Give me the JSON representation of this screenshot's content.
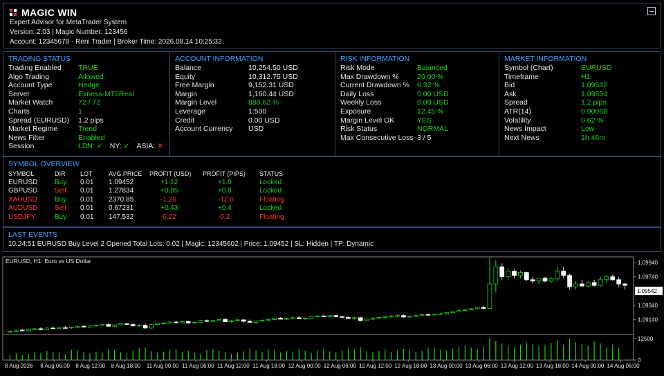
{
  "header": {
    "title": "MAGIC WIN",
    "subtitle": "Expert Advisor for MetaTrader System",
    "version_line": "Version: 2.03   |   Magic Number: 123456",
    "account_line": "Account: 12345678 - Reni Trader   |   Broker Time: 2026.08.14 10:25:32",
    "logo_colors": [
      "#d93b3b",
      "#ffffff",
      "#ffffff",
      "#d93b3b"
    ]
  },
  "trading_status": {
    "title": "TRADING STATUS",
    "rows": [
      {
        "k": "Trading Enabled",
        "v": "TRUE",
        "c": "green"
      },
      {
        "k": "Algo Trading",
        "v": "Allowed",
        "c": "green"
      },
      {
        "k": "Account Type",
        "v": "Hedge",
        "c": "green"
      },
      {
        "k": "Server",
        "v": "Exness-MT5Real",
        "c": "green"
      },
      {
        "k": "Market Watch",
        "v": "72 / 72",
        "c": "green"
      },
      {
        "k": "Charts",
        "v": "1",
        "c": "green"
      },
      {
        "k": "Spread (EURUSD)",
        "v": "1.2 pips",
        "c": "white"
      },
      {
        "k": "Market Regime",
        "v": "Trend",
        "c": "green"
      },
      {
        "k": "News Filter",
        "v": "Enabled",
        "c": "green"
      }
    ],
    "session_label": "Session",
    "sessions": [
      {
        "name": "LDN:",
        "mark": "✓",
        "c": "green"
      },
      {
        "name": "NY:",
        "mark": "✓",
        "c": "green"
      },
      {
        "name": "ASIA:",
        "mark": "✕",
        "c": "red"
      }
    ]
  },
  "account_info": {
    "title": "ACCOUNT INFORMATION",
    "rows": [
      {
        "k": "Balance",
        "v": "10,254.50 USD",
        "c": "white"
      },
      {
        "k": "Equity",
        "v": "10,312.75 USD",
        "c": "white"
      },
      {
        "k": "Free Margin",
        "v": "9,152.31 USD",
        "c": "white"
      },
      {
        "k": "Margin",
        "v": "1,160.44 USD",
        "c": "white"
      },
      {
        "k": "Margin Level",
        "v": "888.62 %",
        "c": "green"
      },
      {
        "k": "Leverage",
        "v": "1:500",
        "c": "white"
      },
      {
        "k": "Credit",
        "v": "0.00 USD",
        "c": "white"
      },
      {
        "k": "Account Currency",
        "v": "USD",
        "c": "white"
      }
    ]
  },
  "risk_info": {
    "title": "RISK INFORMATION",
    "rows": [
      {
        "k": "Risk Mode",
        "v": "Balanced",
        "c": "green"
      },
      {
        "k": "Max Drawdown %",
        "v": "20.00 %",
        "c": "green"
      },
      {
        "k": "Current Drawdown %",
        "v": "6.32 %",
        "c": "green"
      },
      {
        "k": "Daily Loss",
        "v": "0.00 USD",
        "c": "green"
      },
      {
        "k": "Weekly Loss",
        "v": "0.00 USD",
        "c": "green"
      },
      {
        "k": "Exposure",
        "v": "12.45 %",
        "c": "green"
      },
      {
        "k": "Margin Level OK",
        "v": "YES",
        "c": "green"
      },
      {
        "k": "Risk Status",
        "v": "NORMAL",
        "c": "green"
      },
      {
        "k": "Max Consecutive Loss",
        "v": "3 / 5",
        "c": "white"
      }
    ]
  },
  "market_info": {
    "title": "MARKET INFORMATION",
    "rows": [
      {
        "k": "Symbol (Chart)",
        "v": "EURUSD",
        "c": "green"
      },
      {
        "k": "Timeframe",
        "v": "H1",
        "c": "green"
      },
      {
        "k": "Bid",
        "v": "1.09542",
        "c": "green"
      },
      {
        "k": "Ask",
        "v": "1.09554",
        "c": "green"
      },
      {
        "k": "Spread",
        "v": "1.2 pips",
        "c": "green"
      },
      {
        "k": "ATR(14)",
        "v": "0.00068",
        "c": "green"
      },
      {
        "k": "Volatility",
        "v": "0.62 %",
        "c": "green"
      },
      {
        "k": "News Impact",
        "v": "Low",
        "c": "green"
      },
      {
        "k": "Next News",
        "v": "1h 46m",
        "c": "green"
      }
    ]
  },
  "symbol_overview": {
    "title": "SYMBOL OVERVIEW",
    "headers": [
      "SYMBOL",
      "DIR",
      "LOT",
      "AVG PRICE",
      "PROFIT (USD)",
      "PROFIT (PIPS)",
      "STATUS"
    ],
    "rows": [
      {
        "symbol": "EURUSD",
        "dir": "Buy",
        "lot": "0.01",
        "avg": "1.09452",
        "usd": "+1.12",
        "pips": "+1.0",
        "status": "Locked",
        "sc": "white",
        "dc": "green",
        "pc": "green",
        "stc": "green"
      },
      {
        "symbol": "GBPUSD",
        "dir": "Sell",
        "lot": "0.01",
        "avg": "1.27834",
        "usd": "+0.85",
        "pips": "+0.8",
        "status": "Locked",
        "sc": "white",
        "dc": "red",
        "pc": "green",
        "stc": "green"
      },
      {
        "symbol": "XAUUSD",
        "dir": "Buy",
        "lot": "0.01",
        "avg": "2370.85",
        "usd": "-1.26",
        "pips": "-12.6",
        "status": "Floating",
        "sc": "red",
        "dc": "green",
        "pc": "red",
        "stc": "red"
      },
      {
        "symbol": "AUDUSD",
        "dir": "Sell",
        "lot": "0.01",
        "avg": "0.67231",
        "usd": "+0.43",
        "pips": "+0.4",
        "status": "Locked",
        "sc": "red",
        "dc": "red",
        "pc": "green",
        "stc": "green"
      },
      {
        "symbol": "USDJPY",
        "dir": "Buy",
        "lot": "0.01",
        "avg": "147.532",
        "usd": "-0.22",
        "pips": "-0.2",
        "status": "Floating",
        "sc": "red",
        "dc": "green",
        "pc": "red",
        "stc": "red"
      }
    ]
  },
  "last_events": {
    "title": "LAST EVENTS",
    "line": "10:24:51   EURUSD   Buy Level 2 Opened   Total Lots: 0.02   |   Magic: 12345602   |   Price: 1.09452   |   SL: Hidden   |   TP: Dynamic"
  },
  "chart_data": {
    "type": "candlestick",
    "title": "EURUSD, H1:  Euro vs US Dollar",
    "bid_label": "1.09542",
    "y_tick_labels": [
      "1.09940",
      "1.09740",
      "1.09340",
      "1.09140"
    ],
    "y_ticks": [
      1.0994,
      1.0974,
      1.0934,
      1.0914
    ],
    "ylim": [
      1.0894,
      1.1
    ],
    "volume_tick_labels": [
      "12500",
      "0"
    ],
    "volume_ylim": [
      0,
      14000
    ],
    "x_tick_labels": [
      "8 Aug 2026",
      "8 Aug 06:00",
      "8 Aug 12:00",
      "8 Aug 18:00",
      "11 Aug 00:00",
      "11 Aug 06:00",
      "11 Aug 12:00",
      "11 Aug 18:00",
      "12 Aug 00:00",
      "12 Aug 06:00",
      "12 Aug 12:00",
      "12 Aug 18:00",
      "13 Aug 00:00",
      "13 Aug 06:00",
      "13 Aug 12:00",
      "13 Aug 18:00",
      "14 Aug 00:00",
      "14 Aug 06:00"
    ],
    "candles": [
      {
        "o": 1.0896,
        "h": 1.08985,
        "l": 1.0895,
        "c": 1.08975
      },
      {
        "o": 1.08975,
        "h": 1.09,
        "l": 1.08965,
        "c": 1.0899
      },
      {
        "o": 1.0899,
        "h": 1.0901,
        "l": 1.08975,
        "c": 1.0898
      },
      {
        "o": 1.0898,
        "h": 1.09015,
        "l": 1.0897,
        "c": 1.09005
      },
      {
        "o": 1.09005,
        "h": 1.09025,
        "l": 1.08995,
        "c": 1.0901
      },
      {
        "o": 1.0901,
        "h": 1.0903,
        "l": 1.0899,
        "c": 1.09
      },
      {
        "o": 1.09,
        "h": 1.0903,
        "l": 1.08995,
        "c": 1.0902
      },
      {
        "o": 1.0902,
        "h": 1.0904,
        "l": 1.09005,
        "c": 1.09015
      },
      {
        "o": 1.09015,
        "h": 1.09035,
        "l": 1.09005,
        "c": 1.09025
      },
      {
        "o": 1.09025,
        "h": 1.09045,
        "l": 1.0901,
        "c": 1.0902
      },
      {
        "o": 1.0902,
        "h": 1.0904,
        "l": 1.0901,
        "c": 1.0903
      },
      {
        "o": 1.0903,
        "h": 1.09055,
        "l": 1.0902,
        "c": 1.09045
      },
      {
        "o": 1.09045,
        "h": 1.0906,
        "l": 1.09025,
        "c": 1.09035
      },
      {
        "o": 1.09035,
        "h": 1.09055,
        "l": 1.0903,
        "c": 1.0905
      },
      {
        "o": 1.0905,
        "h": 1.0907,
        "l": 1.0904,
        "c": 1.0906
      },
      {
        "o": 1.0906,
        "h": 1.0908,
        "l": 1.0905,
        "c": 1.0907
      },
      {
        "o": 1.0907,
        "h": 1.09085,
        "l": 1.0904,
        "c": 1.09045
      },
      {
        "o": 1.09045,
        "h": 1.0907,
        "l": 1.09035,
        "c": 1.09065
      },
      {
        "o": 1.09065,
        "h": 1.09085,
        "l": 1.09055,
        "c": 1.0908
      },
      {
        "o": 1.0908,
        "h": 1.09095,
        "l": 1.0906,
        "c": 1.0907
      },
      {
        "o": 1.0907,
        "h": 1.0909,
        "l": 1.09045,
        "c": 1.0905
      },
      {
        "o": 1.0905,
        "h": 1.09075,
        "l": 1.0904,
        "c": 1.0906
      },
      {
        "o": 1.0906,
        "h": 1.0908,
        "l": 1.0901,
        "c": 1.0902
      },
      {
        "o": 1.0902,
        "h": 1.0908,
        "l": 1.09005,
        "c": 1.0907
      },
      {
        "o": 1.0907,
        "h": 1.0909,
        "l": 1.0906,
        "c": 1.09085
      },
      {
        "o": 1.09085,
        "h": 1.091,
        "l": 1.0907,
        "c": 1.0909
      },
      {
        "o": 1.0909,
        "h": 1.09115,
        "l": 1.0908,
        "c": 1.09105
      },
      {
        "o": 1.09105,
        "h": 1.09125,
        "l": 1.09085,
        "c": 1.09095
      },
      {
        "o": 1.09095,
        "h": 1.0912,
        "l": 1.0909,
        "c": 1.0911
      },
      {
        "o": 1.0911,
        "h": 1.09125,
        "l": 1.09085,
        "c": 1.0909
      },
      {
        "o": 1.0909,
        "h": 1.09115,
        "l": 1.0908,
        "c": 1.091
      },
      {
        "o": 1.091,
        "h": 1.09135,
        "l": 1.09095,
        "c": 1.09125
      },
      {
        "o": 1.09125,
        "h": 1.0914,
        "l": 1.09105,
        "c": 1.09115
      },
      {
        "o": 1.09115,
        "h": 1.09135,
        "l": 1.091,
        "c": 1.09125
      },
      {
        "o": 1.09125,
        "h": 1.0915,
        "l": 1.09115,
        "c": 1.0914
      },
      {
        "o": 1.0914,
        "h": 1.0916,
        "l": 1.09105,
        "c": 1.0911
      },
      {
        "o": 1.0911,
        "h": 1.09135,
        "l": 1.09095,
        "c": 1.09125
      },
      {
        "o": 1.09125,
        "h": 1.09145,
        "l": 1.09115,
        "c": 1.09135
      },
      {
        "o": 1.09135,
        "h": 1.0915,
        "l": 1.091,
        "c": 1.09115
      },
      {
        "o": 1.09115,
        "h": 1.0914,
        "l": 1.0909,
        "c": 1.091
      },
      {
        "o": 1.091,
        "h": 1.09125,
        "l": 1.0908,
        "c": 1.0912
      },
      {
        "o": 1.0912,
        "h": 1.0914,
        "l": 1.0911,
        "c": 1.0913
      },
      {
        "o": 1.0913,
        "h": 1.0915,
        "l": 1.0912,
        "c": 1.0914
      },
      {
        "o": 1.0914,
        "h": 1.0917,
        "l": 1.09125,
        "c": 1.0916
      },
      {
        "o": 1.0916,
        "h": 1.09175,
        "l": 1.0914,
        "c": 1.09145
      },
      {
        "o": 1.09145,
        "h": 1.09165,
        "l": 1.0913,
        "c": 1.09155
      },
      {
        "o": 1.09155,
        "h": 1.09175,
        "l": 1.09145,
        "c": 1.09165
      },
      {
        "o": 1.09165,
        "h": 1.09185,
        "l": 1.09145,
        "c": 1.0915
      },
      {
        "o": 1.0915,
        "h": 1.0917,
        "l": 1.09135,
        "c": 1.0916
      },
      {
        "o": 1.0916,
        "h": 1.09195,
        "l": 1.0915,
        "c": 1.09185
      },
      {
        "o": 1.09185,
        "h": 1.09205,
        "l": 1.0917,
        "c": 1.0919
      },
      {
        "o": 1.0919,
        "h": 1.0921,
        "l": 1.09175,
        "c": 1.0918
      },
      {
        "o": 1.0918,
        "h": 1.092,
        "l": 1.09165,
        "c": 1.09195
      },
      {
        "o": 1.09195,
        "h": 1.09205,
        "l": 1.0917,
        "c": 1.0918
      },
      {
        "o": 1.0918,
        "h": 1.09195,
        "l": 1.0916,
        "c": 1.0917
      },
      {
        "o": 1.0917,
        "h": 1.09185,
        "l": 1.09145,
        "c": 1.09155
      },
      {
        "o": 1.09155,
        "h": 1.0918,
        "l": 1.0914,
        "c": 1.09165
      },
      {
        "o": 1.09165,
        "h": 1.0918,
        "l": 1.09115,
        "c": 1.09125
      },
      {
        "o": 1.09125,
        "h": 1.09155,
        "l": 1.09115,
        "c": 1.09145
      },
      {
        "o": 1.09145,
        "h": 1.0917,
        "l": 1.09135,
        "c": 1.0916
      },
      {
        "o": 1.0916,
        "h": 1.0918,
        "l": 1.0915,
        "c": 1.0917
      },
      {
        "o": 1.0917,
        "h": 1.0919,
        "l": 1.09155,
        "c": 1.0918
      },
      {
        "o": 1.0918,
        "h": 1.09195,
        "l": 1.09165,
        "c": 1.0919
      },
      {
        "o": 1.0919,
        "h": 1.0921,
        "l": 1.09175,
        "c": 1.09195
      },
      {
        "o": 1.09195,
        "h": 1.0921,
        "l": 1.0917,
        "c": 1.09175
      },
      {
        "o": 1.09175,
        "h": 1.09195,
        "l": 1.0916,
        "c": 1.09185
      },
      {
        "o": 1.09185,
        "h": 1.09205,
        "l": 1.09175,
        "c": 1.092
      },
      {
        "o": 1.092,
        "h": 1.09215,
        "l": 1.0919,
        "c": 1.0921
      },
      {
        "o": 1.0921,
        "h": 1.0922,
        "l": 1.09195,
        "c": 1.09205
      },
      {
        "o": 1.09205,
        "h": 1.0922,
        "l": 1.09195,
        "c": 1.09215
      },
      {
        "o": 1.09215,
        "h": 1.0923,
        "l": 1.09205,
        "c": 1.0922
      },
      {
        "o": 1.0922,
        "h": 1.0924,
        "l": 1.0921,
        "c": 1.09235
      },
      {
        "o": 1.09235,
        "h": 1.0926,
        "l": 1.09225,
        "c": 1.0925
      },
      {
        "o": 1.0925,
        "h": 1.09275,
        "l": 1.0924,
        "c": 1.09265
      },
      {
        "o": 1.09265,
        "h": 1.0929,
        "l": 1.0925,
        "c": 1.0928
      },
      {
        "o": 1.0928,
        "h": 1.093,
        "l": 1.0927,
        "c": 1.0929
      },
      {
        "o": 1.0929,
        "h": 1.0932,
        "l": 1.0928,
        "c": 1.0931
      },
      {
        "o": 1.0931,
        "h": 1.0933,
        "l": 1.09285,
        "c": 1.09295
      },
      {
        "o": 1.09295,
        "h": 1.1001,
        "l": 1.0929,
        "c": 1.0964
      },
      {
        "o": 1.0964,
        "h": 1.0998,
        "l": 1.0952,
        "c": 1.0988
      },
      {
        "o": 1.0988,
        "h": 1.0993,
        "l": 1.097,
        "c": 1.0974
      },
      {
        "o": 1.0974,
        "h": 1.0986,
        "l": 1.097,
        "c": 1.0982
      },
      {
        "o": 1.0982,
        "h": 1.0985,
        "l": 1.0972,
        "c": 1.0976
      },
      {
        "o": 1.0976,
        "h": 1.0983,
        "l": 1.0972,
        "c": 1.098
      },
      {
        "o": 1.098,
        "h": 1.0981,
        "l": 1.0968,
        "c": 1.097
      },
      {
        "o": 1.097,
        "h": 1.0974,
        "l": 1.0965,
        "c": 1.0968
      },
      {
        "o": 1.0968,
        "h": 1.0973,
        "l": 1.0964,
        "c": 1.0972
      },
      {
        "o": 1.0972,
        "h": 1.0974,
        "l": 1.0966,
        "c": 1.0968
      },
      {
        "o": 1.0968,
        "h": 1.0974,
        "l": 1.0965,
        "c": 1.0971
      },
      {
        "o": 1.0971,
        "h": 1.0988,
        "l": 1.0968,
        "c": 1.0982
      },
      {
        "o": 1.0982,
        "h": 1.0988,
        "l": 1.0972,
        "c": 1.0976
      },
      {
        "o": 1.0976,
        "h": 1.0978,
        "l": 1.0956,
        "c": 1.096
      },
      {
        "o": 1.096,
        "h": 1.0968,
        "l": 1.0956,
        "c": 1.0964
      },
      {
        "o": 1.0964,
        "h": 1.097,
        "l": 1.096,
        "c": 1.0961
      },
      {
        "o": 1.0961,
        "h": 1.0968,
        "l": 1.0959,
        "c": 1.0966
      },
      {
        "o": 1.0966,
        "h": 1.097,
        "l": 1.096,
        "c": 1.0962
      },
      {
        "o": 1.0962,
        "h": 1.0974,
        "l": 1.096,
        "c": 1.097
      },
      {
        "o": 1.097,
        "h": 1.0976,
        "l": 1.0966,
        "c": 1.0974
      },
      {
        "o": 1.0974,
        "h": 1.0977,
        "l": 1.0968,
        "c": 1.097
      },
      {
        "o": 1.097,
        "h": 1.0974,
        "l": 1.096,
        "c": 1.0964
      },
      {
        "o": 1.0964,
        "h": 1.0966,
        "l": 1.0956,
        "c": 1.0962
      }
    ],
    "volumes": [
      3200,
      4100,
      2800,
      3600,
      4500,
      3900,
      5200,
      4800,
      4000,
      3500,
      6100,
      5400,
      4700,
      3800,
      5000,
      4200,
      6300,
      5800,
      4400,
      3900,
      5600,
      6800,
      7200,
      5100,
      4300,
      4900,
      5700,
      6200,
      4600,
      5300,
      4100,
      3700,
      5900,
      6400,
      5200,
      4800,
      3600,
      4400,
      5100,
      6700,
      5500,
      4700,
      6100,
      5800,
      4300,
      5200,
      4900,
      6600,
      5400,
      4100,
      5800,
      6300,
      5000,
      4400,
      5700,
      6900,
      6200,
      7400,
      5100,
      4600,
      5300,
      6100,
      4800,
      5600,
      6400,
      5900,
      4700,
      5200,
      6800,
      7300,
      6100,
      5500,
      6700,
      7800,
      8200,
      7100,
      6400,
      7900,
      12800,
      11200,
      9600,
      8300,
      7400,
      8900,
      10100,
      9400,
      7800,
      8600,
      9800,
      11500,
      8700,
      12600,
      10400,
      9100,
      8200,
      10800,
      9600,
      7400,
      8800,
      6900
    ]
  },
  "colors": {
    "border": "#2e4a68",
    "section_title": "#3fa0ff",
    "positive": "#19d619",
    "negative": "#ff3b30",
    "candle_up": "#19d619",
    "candle_down": "#ffffff"
  }
}
